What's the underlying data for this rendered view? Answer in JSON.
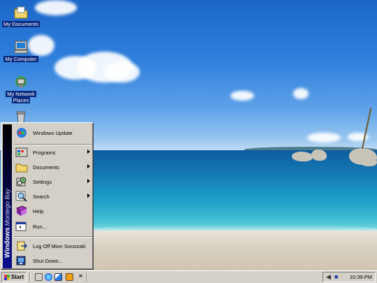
{
  "desktop_icons": [
    {
      "label": "My Documents",
      "icon": "folder-icon"
    },
    {
      "label": "My Computer",
      "icon": "computer-icon"
    },
    {
      "label_line1": "My Network",
      "label_line2": "Places",
      "icon": "network-icon"
    },
    {
      "label": "",
      "icon": "recycle-bin-icon"
    }
  ],
  "start_menu": {
    "banner_brand": "Windows",
    "banner_edition": "Montego Bay",
    "items": [
      {
        "label": "Windows Update",
        "icon": "windows-update-icon",
        "submenu": false
      },
      {
        "label": "Programs",
        "icon": "programs-icon",
        "submenu": true
      },
      {
        "label": "Documents",
        "icon": "documents-folder-icon",
        "submenu": true
      },
      {
        "label": "Settings",
        "icon": "settings-icon",
        "submenu": true
      },
      {
        "label": "Search",
        "icon": "search-icon",
        "submenu": true
      },
      {
        "label": "Help",
        "icon": "help-book-icon",
        "submenu": false
      },
      {
        "label": "Run...",
        "icon": "run-icon",
        "submenu": false
      },
      {
        "label": "Log Off Mion Sonozaki",
        "icon": "log-off-icon",
        "submenu": false
      },
      {
        "label": "Shut Down...",
        "icon": "shut-down-icon",
        "submenu": false
      }
    ]
  },
  "taskbar": {
    "start_label": "Start",
    "quick_launch": [
      "show-desktop-icon",
      "internet-explorer-icon",
      "outlook-express-icon",
      "media-player-icon"
    ],
    "overflow": "»",
    "clock": "10:39 PM",
    "tray_icons": [
      "volume-icon",
      "network-tray-icon"
    ]
  },
  "colors": {
    "menu_bg": "#d4d0c8",
    "banner_top": "#000000",
    "banner_bottom": "#0b0e8e",
    "desktop_sky": "#2f7fdc"
  }
}
